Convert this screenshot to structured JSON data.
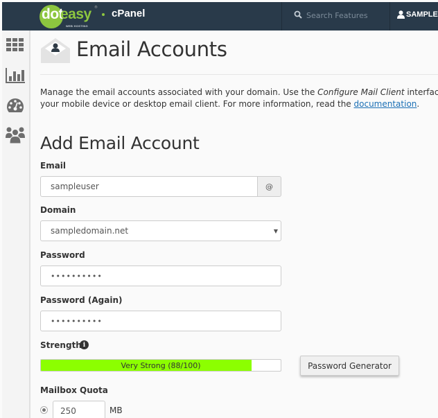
{
  "header": {
    "brand_logo_main": "dot",
    "brand_logo_accent": "easy",
    "brand_logo_reg": "®",
    "brand_logo_sub": "WEB HOSTING",
    "app_name": "cPanel",
    "search_placeholder": "Search Features",
    "user_label": "SAMPLE"
  },
  "sidebar": {
    "items": [
      {
        "name": "tools",
        "icon": "grid-icon"
      },
      {
        "name": "statistics",
        "icon": "bar-chart-icon"
      },
      {
        "name": "dashboard",
        "icon": "speedometer-icon"
      },
      {
        "name": "users",
        "icon": "users-icon"
      }
    ]
  },
  "page": {
    "title": "Email Accounts",
    "description_part1": "Manage the email accounts associated with your domain. Use the ",
    "description_em": "Configure Mail Client",
    "description_part2": " interface to",
    "description_line2": "your mobile device or desktop email client. For more information, read the ",
    "description_link": "documentation",
    "description_end": "."
  },
  "form": {
    "section_title": "Add Email Account",
    "email_label": "Email",
    "email_value": "sampleuser",
    "at_symbol": "@",
    "domain_label": "Domain",
    "domain_value": "sampledomain.net",
    "domain_caret": "▼",
    "password_label": "Password",
    "password_value": "••••••••••",
    "password_again_label": "Password (Again)",
    "password_again_value": "••••••••••",
    "strength_label": "Strength",
    "strength_info": "i",
    "strength_text": "Very Strong (88/100)",
    "strength_score": 88,
    "strength_max": 100,
    "strength_color": "#8cff00",
    "password_generator_label": "Password Generator",
    "quota_label": "Mailbox Quota",
    "quota_value": "250",
    "quota_unit": "MB"
  }
}
